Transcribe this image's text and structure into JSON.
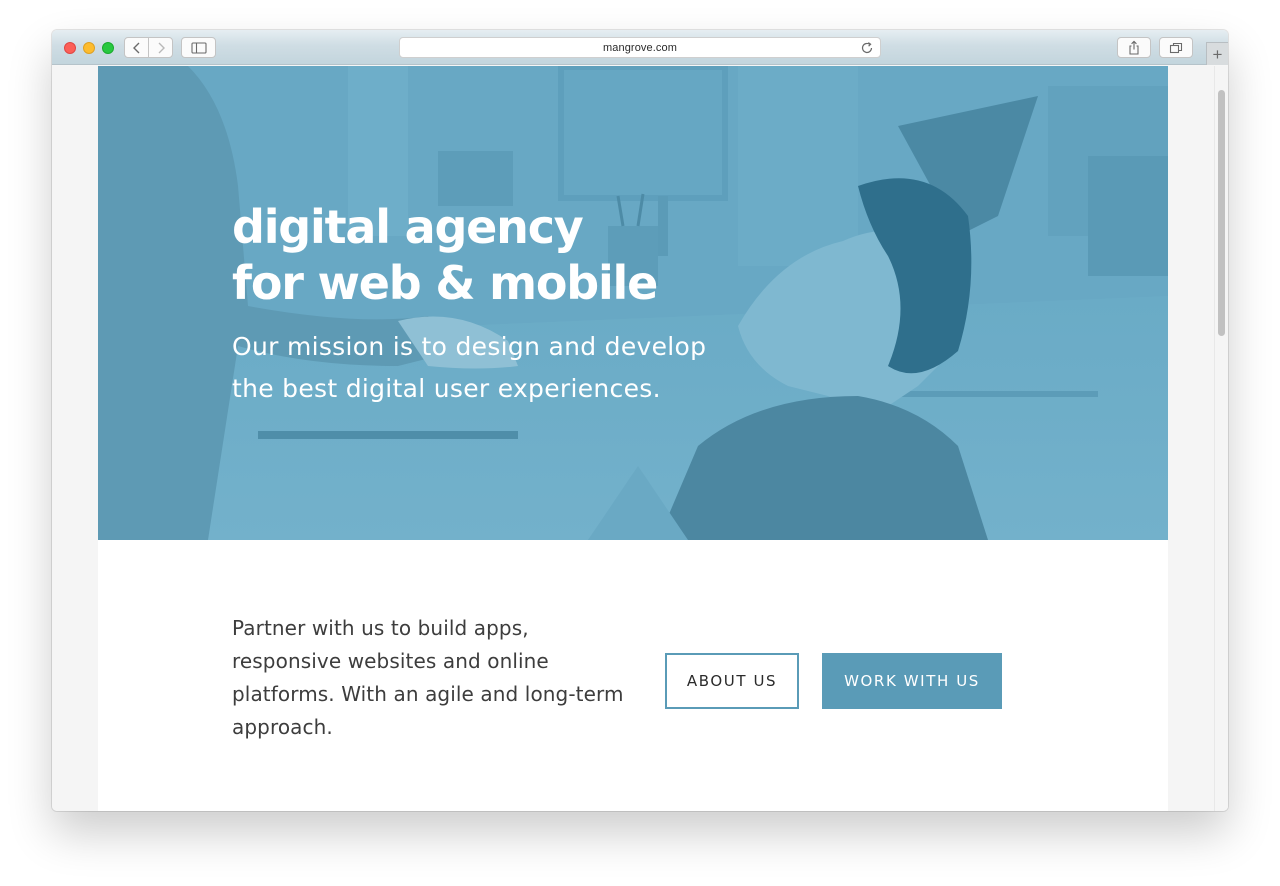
{
  "browser": {
    "url": "mangrove.com",
    "accent_toolbar": "#c9dae2"
  },
  "hero": {
    "title_line1": "digital agency",
    "title_line2": "for web & mobile",
    "subtitle_line1": "Our mission is to design and develop",
    "subtitle_line2": "the best digital user experiences.",
    "overlay_color": "#68a8c4"
  },
  "intro": {
    "text": "Partner with us to build apps, responsive websites and online platforms. With an agile and long-term approach."
  },
  "actions": {
    "about_label": "ABOUT US",
    "work_label": "WORK WITH US",
    "brand_color": "#5a9bb7"
  },
  "icons": {
    "back": "chevron-left-icon",
    "forward": "chevron-right-icon",
    "sidebar": "sidebar-icon",
    "reload": "reload-icon",
    "share": "share-icon",
    "tabs": "tabs-icon",
    "new_tab": "plus-icon"
  }
}
